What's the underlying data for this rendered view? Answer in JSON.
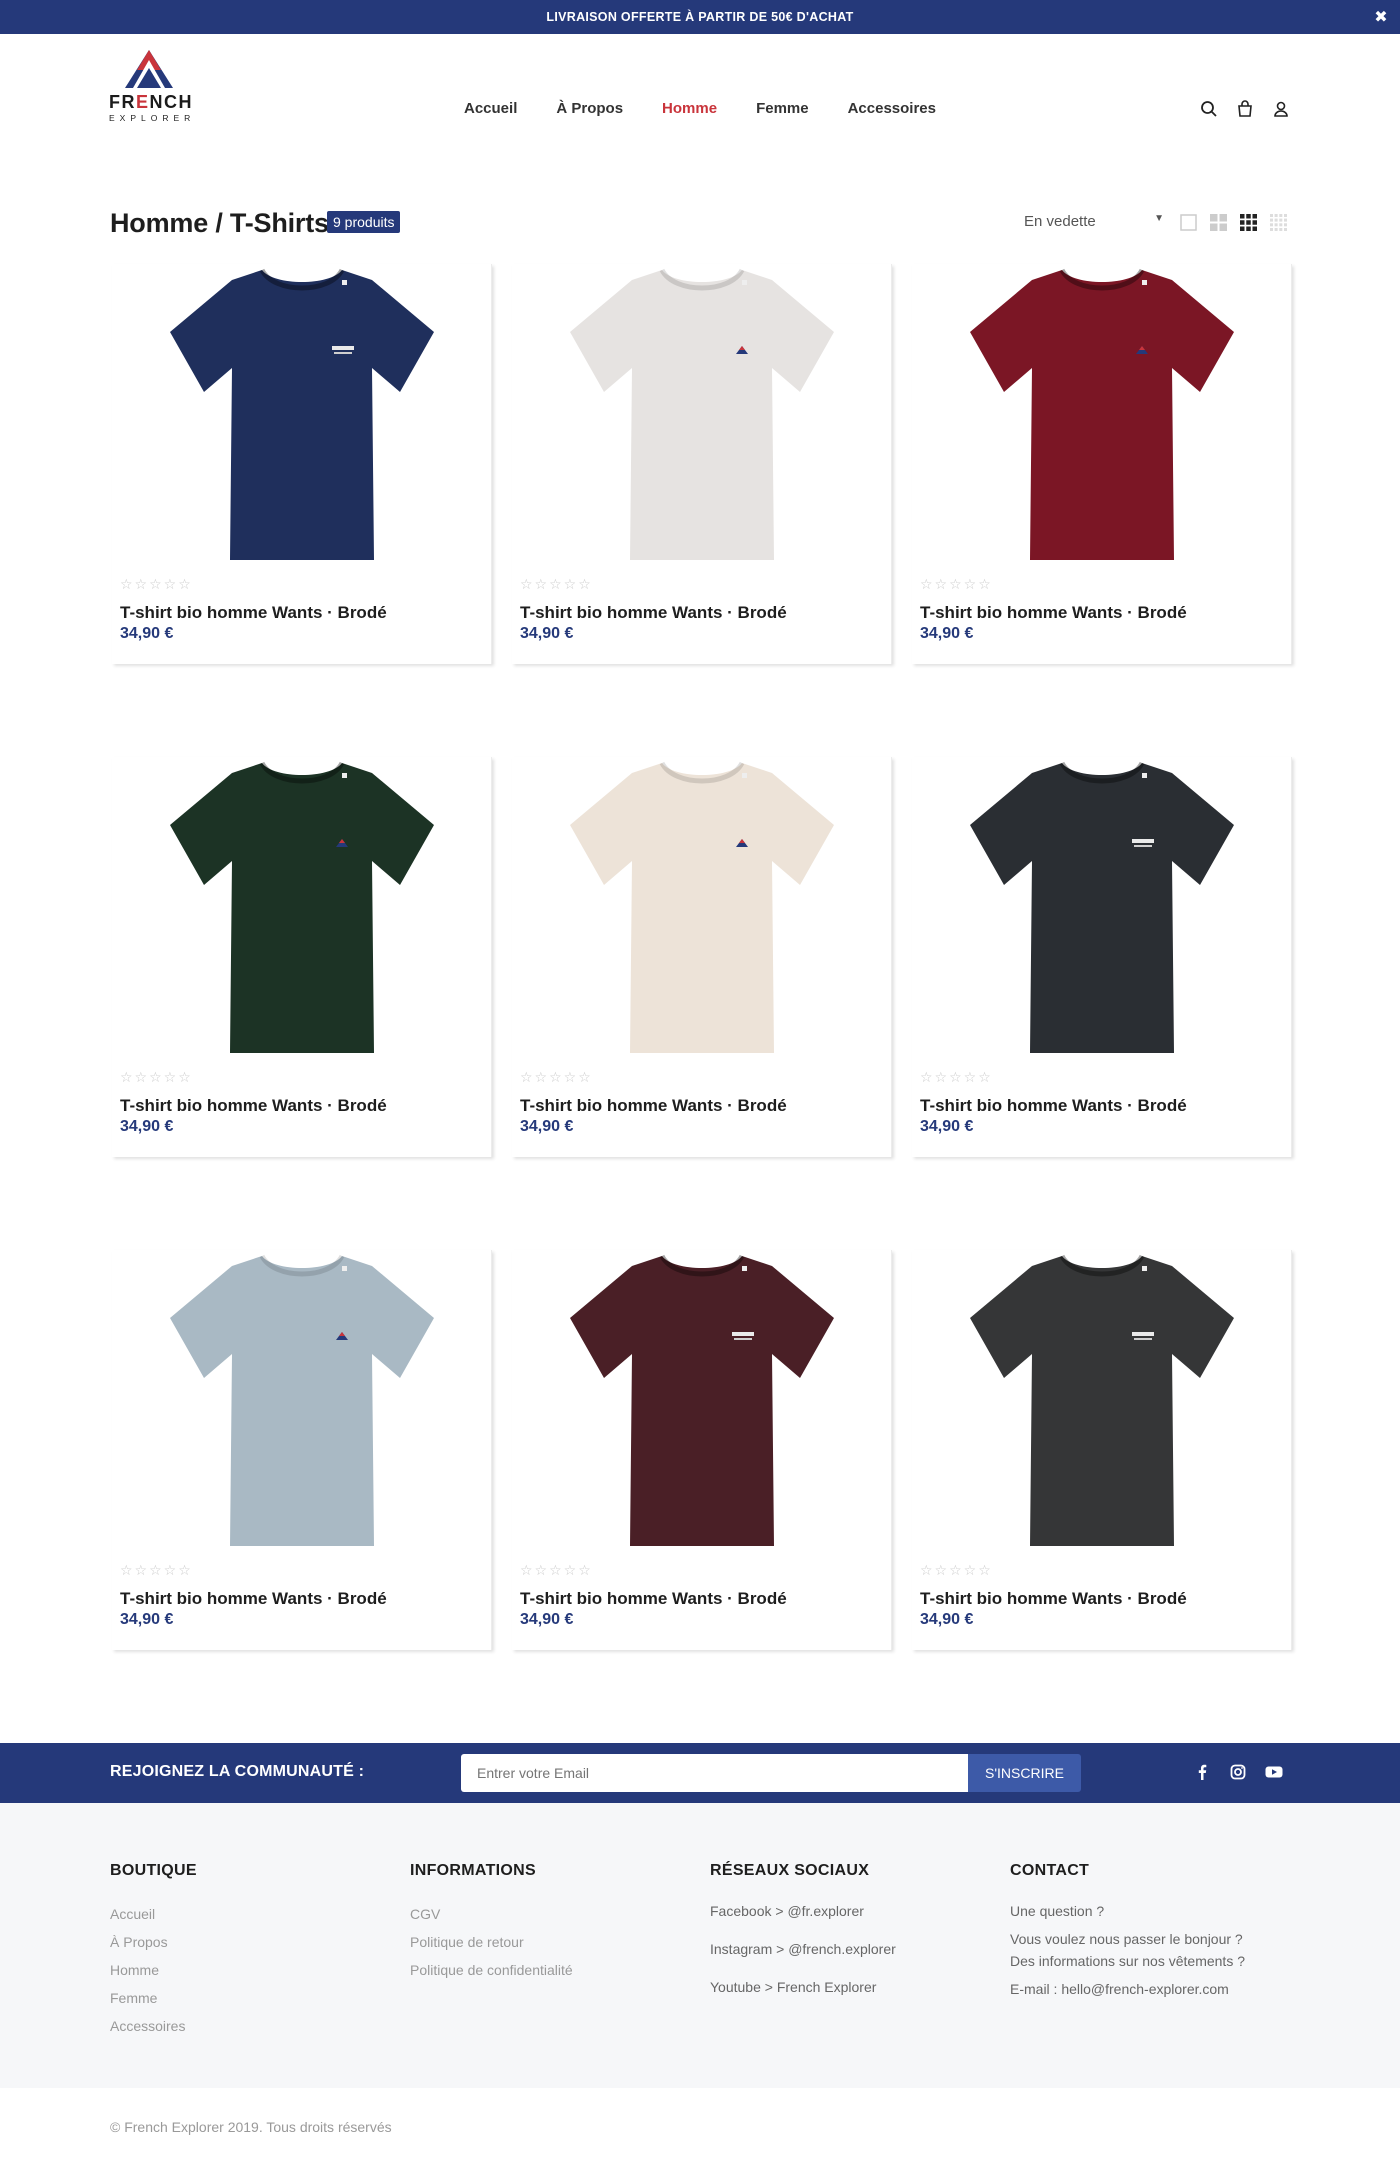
{
  "announcement": {
    "text": "LIVRAISON OFFERTE À PARTIR DE 50€ D'ACHAT",
    "close": "✖"
  },
  "brand": {
    "name_pre": "FR",
    "name_accent": "E",
    "name_post": "NCH",
    "sub": "EXPLORER"
  },
  "nav": [
    {
      "label": "Accueil",
      "active": false
    },
    {
      "label": "À Propos",
      "active": false
    },
    {
      "label": "Homme",
      "active": true
    },
    {
      "label": "Femme",
      "active": false
    },
    {
      "label": "Accessoires",
      "active": false
    }
  ],
  "header_icons": [
    "search-icon",
    "bag-icon",
    "user-icon"
  ],
  "listing": {
    "title": "Homme / T-Shirts",
    "count": "9 produits",
    "sort_selected": "En vedette",
    "view_toggles": [
      "grid-1-icon",
      "grid-2-icon",
      "grid-3-icon",
      "grid-4-icon"
    ]
  },
  "products": [
    {
      "name": "T-shirt bio homme Wants · Brodé",
      "price": "34,90 €",
      "rating": "☆☆☆☆☆",
      "color": "#1f2f5c",
      "logo": "text"
    },
    {
      "name": "T-shirt bio homme Wants · Brodé",
      "price": "34,90 €",
      "rating": "☆☆☆☆☆",
      "color": "#e6e3e1",
      "logo": "mark"
    },
    {
      "name": "T-shirt bio homme Wants · Brodé",
      "price": "34,90 €",
      "rating": "☆☆☆☆☆",
      "color": "#7b1625",
      "logo": "mark"
    },
    {
      "name": "T-shirt bio homme Wants · Brodé",
      "price": "34,90 €",
      "rating": "☆☆☆☆☆",
      "color": "#1c3325",
      "logo": "mark"
    },
    {
      "name": "T-shirt bio homme Wants · Brodé",
      "price": "34,90 €",
      "rating": "☆☆☆☆☆",
      "color": "#ede3d8",
      "logo": "mark"
    },
    {
      "name": "T-shirt bio homme Wants · Brodé",
      "price": "34,90 €",
      "rating": "☆☆☆☆☆",
      "color": "#2a2e33",
      "logo": "text"
    },
    {
      "name": "T-shirt bio homme Wants · Brodé",
      "price": "34,90 €",
      "rating": "☆☆☆☆☆",
      "color": "#a9b9c4",
      "logo": "mark"
    },
    {
      "name": "T-shirt bio homme Wants · Brodé",
      "price": "34,90 €",
      "rating": "☆☆☆☆☆",
      "color": "#4a1f26",
      "logo": "text"
    },
    {
      "name": "T-shirt bio homme Wants · Brodé",
      "price": "34,90 €",
      "rating": "☆☆☆☆☆",
      "color": "#353637",
      "logo": "text"
    }
  ],
  "newsletter": {
    "label": "REJOIGNEZ LA COMMUNAUTÉ :",
    "placeholder": "Entrer votre Email",
    "button": "S'INSCRIRE",
    "social_icons": [
      "facebook-icon",
      "instagram-icon",
      "youtube-icon"
    ]
  },
  "footer": {
    "boutique": {
      "title": "BOUTIQUE",
      "links": [
        "Accueil",
        "À Propos",
        "Homme",
        "Femme",
        "Accessoires"
      ]
    },
    "informations": {
      "title": "INFORMATIONS",
      "links": [
        "CGV",
        "Politique de retour",
        "Politique de confidentialité"
      ]
    },
    "social": {
      "title": "RÉSEAUX SOCIAUX",
      "links": [
        "Facebook > @fr.explorer",
        "Instagram > @french.explorer",
        "Youtube > French Explorer"
      ]
    },
    "contact": {
      "title": "CONTACT",
      "question": "Une question ?",
      "line1": "Vous voulez nous passer le bonjour ?",
      "line2": "Des informations sur nos vêtements ?",
      "email": "E-mail : hello@french-explorer.com"
    }
  },
  "copyright": "© French Explorer 2019. Tous droits réservés",
  "colors": {
    "navy": "#25397a",
    "accent_red": "#c9343b",
    "button_blue": "#3d5aa8"
  }
}
